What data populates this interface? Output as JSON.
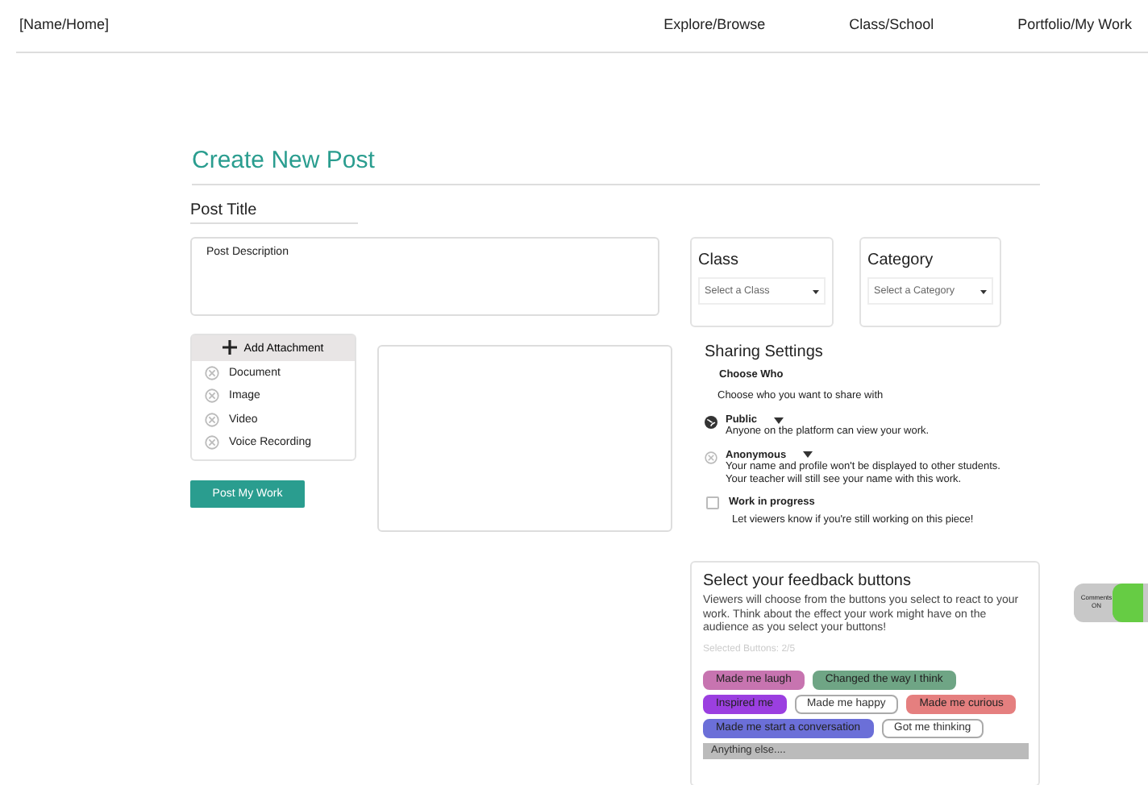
{
  "nav": {
    "home": "[Name/Home]",
    "links": [
      "Explore/Browse",
      "Class/School",
      "Portfolio/My Work"
    ]
  },
  "page_title": "Create New Post",
  "post_title": {
    "placeholder": "Post Title"
  },
  "description": {
    "placeholder": "Post Description"
  },
  "attachment": {
    "header": "Add Attachment",
    "options": [
      "Document",
      "Image",
      "Video",
      "Voice Recording"
    ]
  },
  "post_button": "Post My Work",
  "class_select": {
    "label": "Class",
    "placeholder": "Select a Class"
  },
  "category_select": {
    "label": "Category",
    "placeholder": "Select a Category"
  },
  "sharing": {
    "title": "Sharing Settings",
    "subtitle": "Choose Who",
    "hint": "Choose who you want to share with",
    "options": [
      {
        "kind": "globe",
        "label": "Public",
        "lines": [
          "Anyone on the platform can view your work."
        ]
      },
      {
        "kind": "anon",
        "label": "Anonymous",
        "lines": [
          "Your name and profile won't be displayed to other students.",
          "Your teacher will still see your name with this work."
        ]
      }
    ],
    "wip": {
      "label": "Work in progress",
      "checked": false,
      "hint": "Let viewers know if you're still working on this piece!"
    }
  },
  "feedback": {
    "title": "Select your feedback buttons",
    "text": "Viewers will choose from the buttons you select to react to your work. Think about the effect your work might have on the audience as you select your buttons!",
    "count": "Selected Buttons: 2/5",
    "buttons": [
      {
        "label": "Made me laugh",
        "selected": true,
        "color": "#c774b0"
      },
      {
        "label": "Changed the way I think",
        "selected": true,
        "color": "#6fa585"
      },
      {
        "label": "Inspired me",
        "selected": true,
        "color": "#9b3fe0"
      },
      {
        "label": "Made me happy",
        "selected": false
      },
      {
        "label": "Made me curious",
        "selected": true,
        "color": "#e57f7f"
      },
      {
        "label": "Made me start a conversation",
        "selected": true,
        "color": "#6b6fd8"
      },
      {
        "label": "Got me thinking",
        "selected": false
      }
    ],
    "other": {
      "placeholder": "Anything else...."
    }
  },
  "comments_toggle": {
    "label": "Comments ON",
    "on": true
  }
}
